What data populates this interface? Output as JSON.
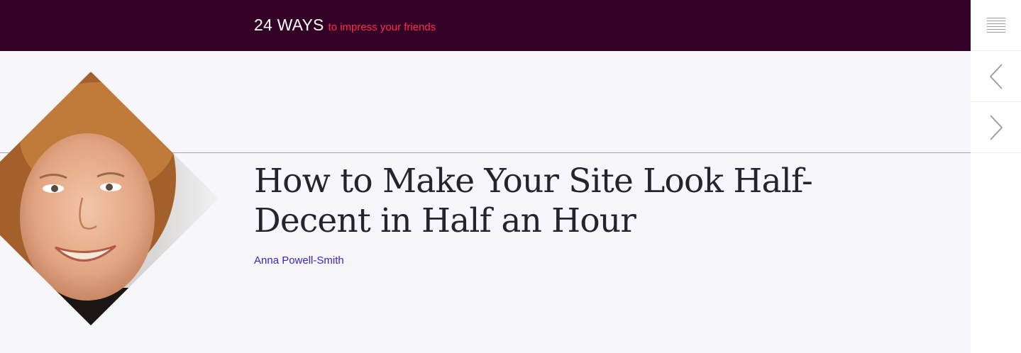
{
  "header": {
    "site_name": "24 WAYS",
    "tagline": "to impress your friends"
  },
  "nav": {
    "menu_icon": "menu-lines-icon",
    "prev_icon": "chevron-left-icon",
    "next_icon": "chevron-right-icon"
  },
  "article": {
    "title": "How to Make Your Site Look Half-Decent in Half an Hour",
    "author": "Anna Powell-Smith"
  },
  "colors": {
    "header_bg": "#330026",
    "tagline": "#ff2a4f",
    "author_link": "#3a23c8",
    "page_bg": "#f7f6fb"
  }
}
